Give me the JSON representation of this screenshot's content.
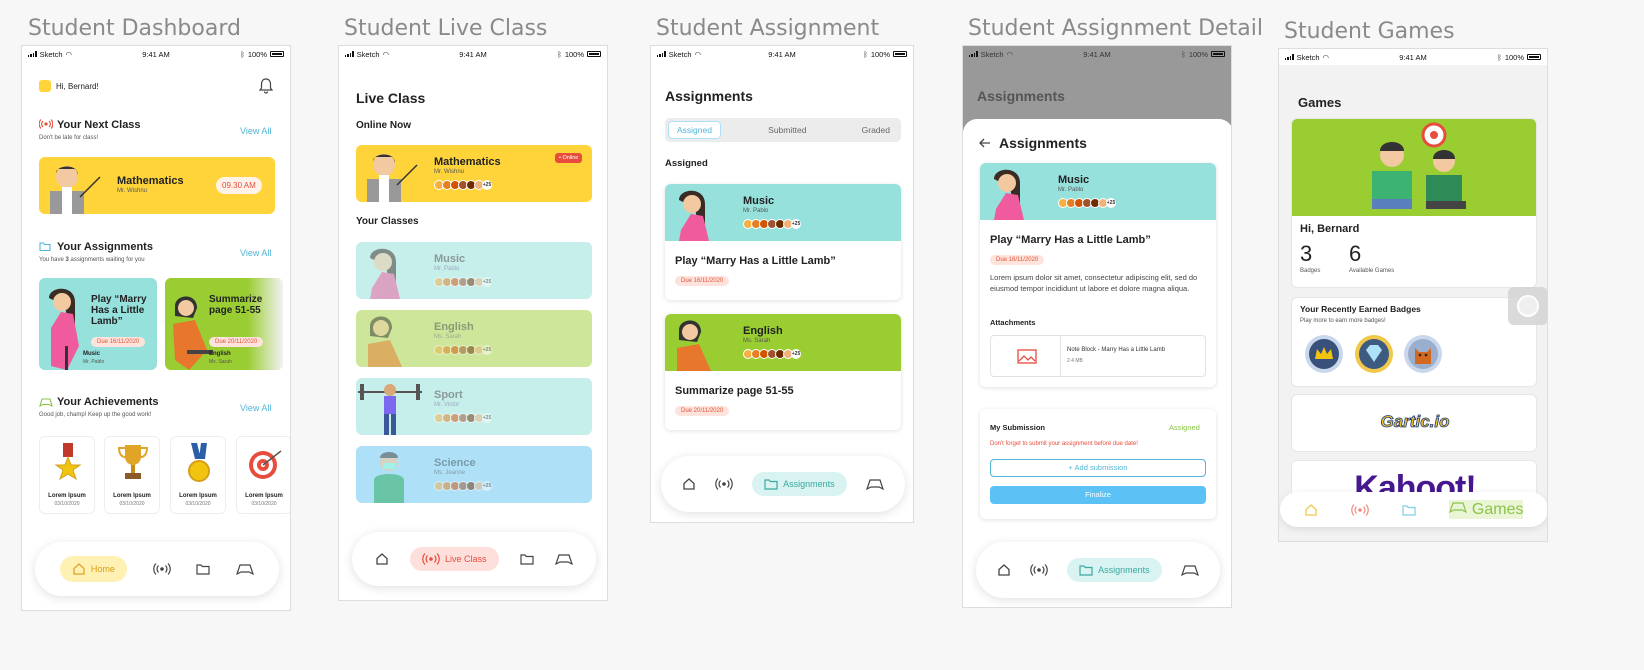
{
  "titles": [
    "Student Dashboard",
    "Student Live Class",
    "Student Assignment",
    "Student Assignment Detail",
    "Student Games"
  ],
  "status": {
    "carrier": "Sketch",
    "time": "9:41 AM",
    "battery": "100%"
  },
  "dashboard": {
    "greeting": "Hi, Bernard!",
    "next_class": {
      "title": "Your Next Class",
      "subtitle": "Don't be late for class!",
      "view_all": "View All",
      "subject": "Mathematics",
      "teacher": "Mr. Wishnu",
      "time": "09.30 AM"
    },
    "assignments": {
      "title": "Your Assignments",
      "subtitle_pre": "You have ",
      "count": "3",
      "subtitle_post": " assignments waiting for you",
      "view_all": "View All",
      "items": [
        {
          "title": "Play “Marry Has a Little Lamb”",
          "due": "Due 16/11/2020",
          "subject": "Music",
          "teacher": "Mr. Pablo"
        },
        {
          "title": "Summarize page 51-55",
          "due": "Due 20/11/2020",
          "subject": "English",
          "teacher": "Ms. Sarah"
        }
      ]
    },
    "achievements": {
      "title": "Your Achievements",
      "subtitle": "Good job, champ! Keep up the good work!",
      "view_all": "View All",
      "items": [
        {
          "name": "Lorem Ipsum",
          "date": "03/10/2020"
        },
        {
          "name": "Lorem Ipsum",
          "date": "03/10/2020"
        },
        {
          "name": "Lorem Ipsum",
          "date": "03/10/2020"
        },
        {
          "name": "Lorem Ipsum",
          "date": "03/10/2020"
        }
      ]
    },
    "nav_home": "Home"
  },
  "live": {
    "title": "Live Class",
    "online_now": "Online Now",
    "online_badge": "• Online",
    "now": {
      "subject": "Mathematics",
      "teacher": "Mr. Wishnu",
      "more": "+25"
    },
    "your_classes": "Your Classes",
    "classes": [
      {
        "subject": "Music",
        "teacher": "Mr. Pablo",
        "more": "+25"
      },
      {
        "subject": "English",
        "teacher": "Ms. Sarah",
        "more": "+25"
      },
      {
        "subject": "Sport",
        "teacher": "Mr. Victor",
        "more": "+25"
      },
      {
        "subject": "Science",
        "teacher": "Ms. Jeanne",
        "more": "+25"
      }
    ],
    "nav_live": "Live Class"
  },
  "assign": {
    "title": "Assignments",
    "tabs": [
      "Assigned",
      "Submitted",
      "Graded"
    ],
    "section": "Assigned",
    "items": [
      {
        "subject": "Music",
        "teacher": "Mr. Pablo",
        "more": "+25",
        "title": "Play “Marry Has a Little Lamb”",
        "due": "Due 16/11/2020"
      },
      {
        "subject": "English",
        "teacher": "Ms. Sarah",
        "more": "+25",
        "title": "Summarize page 51-55",
        "due": "Due 20/11/2020"
      }
    ],
    "nav_assign": "Assignments"
  },
  "detail": {
    "bg_title": "Assignments",
    "title": "Assignments",
    "subject": "Music",
    "teacher": "Mr. Pablo",
    "more": "+25",
    "task": "Play “Marry Has a Little Lamb”",
    "due": "Due 16/11/2020",
    "body": "Lorem ipsum dolor sit amet, consectetur adipiscing elit, sed do eiusmod tempor incididunt ut labore et dolore magna aliqua.",
    "attachments": "Attachments",
    "file_name": "Note Block - Marry Has a Little Lamb",
    "file_size": "2.4 MB",
    "my_submission": "My Submission",
    "status": "Assigned",
    "warning": "Don't forget to submit your assignment before due date!",
    "add": "+ Add submission",
    "finalize": "Finalize",
    "nav_assign": "Assignments"
  },
  "games": {
    "title": "Games",
    "greeting": "Hi, Bernard",
    "badges_count": "3",
    "badges_label": "Badges",
    "games_count": "6",
    "games_label": "Available Games",
    "recent": "Your Recently Earned Badges",
    "recent_sub": "Play more to earn more badges!",
    "game1": "Gartic.io",
    "game2": "Kahoot!",
    "nav_games": "Games"
  },
  "colors": {
    "yellow": "#ffd43b",
    "teal": "#96e1dc",
    "green": "#9acd32",
    "blue": "#aee1f7",
    "red": "#e74c3c",
    "accent": "#4fb6d8"
  }
}
